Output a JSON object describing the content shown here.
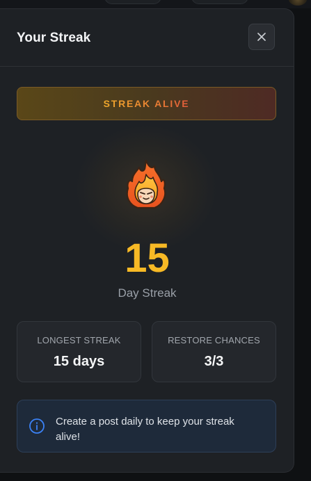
{
  "modal": {
    "title": "Your Streak",
    "close_icon": "close-icon"
  },
  "status": {
    "label": "STREAK ALIVE",
    "colors": [
      "#f0a92c",
      "#e97f33",
      "#e15b3b"
    ]
  },
  "streak": {
    "icon": "fire-icon",
    "count": "15",
    "label": "Day Streak",
    "accent_color": "#f7b925"
  },
  "stats": [
    {
      "label": "LONGEST STREAK",
      "value": "15 days"
    },
    {
      "label": "RESTORE CHANCES",
      "value": "3/3"
    }
  ],
  "info": {
    "icon": "info-icon",
    "text": "Create a post daily to keep your streak alive!",
    "accent_color": "#3b82f6"
  }
}
